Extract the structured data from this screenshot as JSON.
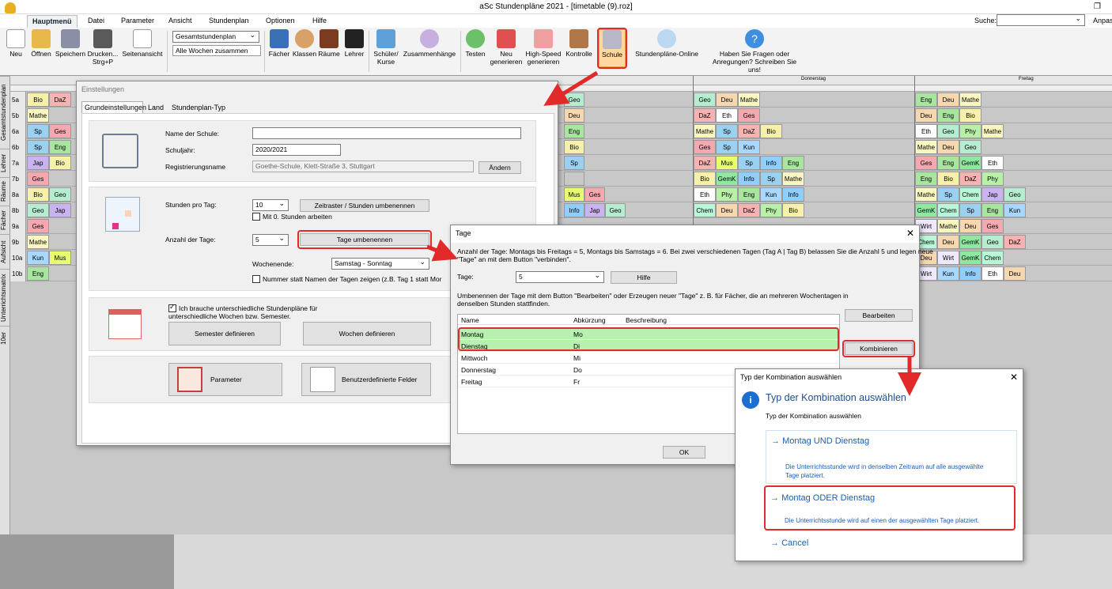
{
  "app": {
    "title": "aSc Stundenpläne 2021  - [timetable (9).roz]"
  },
  "menu": {
    "tabs": [
      "Hauptmenü",
      "Datei",
      "Parameter",
      "Ansicht",
      "Stundenplan",
      "Optionen",
      "Hilfe"
    ],
    "search_label": "Suche:",
    "anpas": "Anpas"
  },
  "ribbon": {
    "neu": "Neu",
    "oeffnen": "Öffnen",
    "speichern": "Speichern",
    "drucken": "Drucken...",
    "drucken2": "Strg+P",
    "seitenansicht": "Seitenansicht",
    "view_select": "Gesamtstundenplan",
    "alle_wochen": "Alle Wochen zusammen",
    "faecher": "Fächer",
    "klassen": "Klassen",
    "raeume": "Räume",
    "lehrer": "Lehrer",
    "schueler": "Schüler/",
    "kurse": "Kurse",
    "zusammenhaenge": "Zusammenhänge",
    "testen": "Testen",
    "neu_gen": "Neu",
    "neu_gen2": "generieren",
    "hs": "High-Speed",
    "hs2": "generieren",
    "kontrolle": "Kontrolle",
    "schule": "Schule",
    "online": "Stundenpläne-Online",
    "fragen": "Haben Sie Fragen oder",
    "fragen2": "Anregungen? Schreiben Sie uns!"
  },
  "sidetabs": [
    "Gesamtstundenplan",
    "Lehrer",
    "Räume",
    "Fächer",
    "Aufsicht",
    "Unterrichtsmatrix",
    "10er"
  ],
  "timetable": {
    "days": [
      "Donnerstag",
      "Freitag"
    ],
    "rows": [
      {
        "cls": "5a",
        "c": [
          "Bio",
          "DaZ"
        ]
      },
      {
        "cls": "5b",
        "c": [
          "Mathe"
        ]
      },
      {
        "cls": "6a",
        "c": [
          "Sp",
          "Ges"
        ]
      },
      {
        "cls": "6b",
        "c": [
          "Sp",
          "Eng"
        ]
      },
      {
        "cls": "7a",
        "c": [
          "Jap",
          "Bio"
        ]
      },
      {
        "cls": "7b",
        "c": [
          "Ges"
        ]
      },
      {
        "cls": "8a",
        "c": [
          "Bio",
          "Geo"
        ]
      },
      {
        "cls": "8b",
        "c": [
          "Geo",
          "Jap"
        ]
      },
      {
        "cls": "9a",
        "c": [
          "Ges"
        ]
      },
      {
        "cls": "9b",
        "c": [
          "Mathe"
        ]
      },
      {
        "cls": "10a",
        "c": [
          "Kun",
          "Mus"
        ]
      },
      {
        "cls": "10b",
        "c": [
          "Eng"
        ]
      }
    ],
    "right1": [
      [
        "Geo",
        "Deu",
        "Mathe"
      ],
      [
        "DaZ",
        "Eth",
        "Ges"
      ],
      [
        "Mathe",
        "Sp",
        "DaZ",
        "Bio"
      ],
      [
        "Ges",
        "Sp",
        "Kun"
      ],
      [
        "DaZ",
        "Mus",
        "Sp",
        "Info",
        "Eng"
      ],
      [
        "Bio",
        "GemK",
        "Info",
        "Sp",
        "Mathe"
      ],
      [
        "Eth",
        "Phy",
        "Eng",
        "Kun",
        "Info"
      ],
      [
        "Chem",
        "Deu",
        "DaZ",
        "Phy",
        "Bio"
      ]
    ],
    "right2": [
      [
        "Eng",
        "Deu",
        "Mathe"
      ],
      [
        "Deu",
        "Eng",
        "Bio"
      ],
      [
        "Eth",
        "Geo",
        "Phy",
        "Mathe"
      ],
      [
        "Mathe",
        "Deu",
        "Geo"
      ],
      [
        "Ges",
        "Eng",
        "GemK",
        "Eth"
      ],
      [
        "Eng",
        "Bio",
        "DaZ",
        "Phy"
      ],
      [
        "Mathe",
        "Sp",
        "Chem",
        "Jap",
        "Geo"
      ],
      [
        "GemK",
        "Chem",
        "Sp",
        "Eng",
        "Kun"
      ],
      [
        "Wirt",
        "Mathe",
        "Deu",
        "Ges"
      ],
      [
        "Chem",
        "Deu",
        "GemK",
        "Geo",
        "DaZ"
      ],
      [
        "Deu",
        "Wirt",
        "GemK",
        "Chem"
      ],
      [
        "Wirt",
        "Kun",
        "Info",
        "Eth",
        "Deu"
      ]
    ],
    "mid": [
      [
        "Geo"
      ],
      [
        "Deu"
      ],
      [
        "Eng"
      ],
      [
        "Bio"
      ],
      [
        "Sp"
      ],
      [
        ""
      ],
      [
        "Mus",
        "Ges"
      ],
      [
        "Info",
        "Jap",
        "Geo"
      ]
    ]
  },
  "einstellungen": {
    "title": "Einstellungen",
    "tabs": [
      "Grundeinstellungen",
      "Land",
      "Stundenplan-Typ"
    ],
    "name_label": "Name der Schule:",
    "name_value": "",
    "jahr_label": "Schuljahr:",
    "jahr_value": "2020/2021",
    "reg_label": "Registrierungsname",
    "reg_value": "Goethe-Schule, Klett-Straße 3, Stuttgart",
    "aendern": "Ändern",
    "stunden_label": "Stunden pro Tag:",
    "stunden_value": "10",
    "zeitraster": "Zeitraster / Stunden umbenennen",
    "null_stunden": "Mit 0. Stunden arbeiten",
    "tage_label": "Anzahl der Tage:",
    "tage_value": "5",
    "tage_umbenennen": "Tage umbenennen",
    "wochenende_label": "Wochenende:",
    "wochenende_value": "Samstag - Sonntag",
    "nummer_label": "Nummer statt Namen der Tagen zeigen (z.B. Tag 1 statt Mor",
    "unterschiedlich": "Ich brauche unterschiedliche Stundenpläne für",
    "unterschiedlich2": "unterschiedliche Wochen bzw. Semester.",
    "semester": "Semester definieren",
    "wochen": "Wochen definieren",
    "parameter": "Parameter",
    "benutzer": "Benutzerdefinierte Felder"
  },
  "tage": {
    "title": "Tage",
    "info": "Anzahl der Tage: Montags bis Freitags = 5, Montags bis Samstags = 6. Bei zwei verschiedenen Tagen (Tag A | Tag B) belassen Sie die Anzahl 5 und legen neue",
    "info2": "\"Tage\" an mit dem Button \"verbinden\".",
    "tage_label": "Tage:",
    "tage_value": "5",
    "hilfe": "Hilfe",
    "hint": "Umbenennen der Tage mit dem Button \"Bearbeiten\" oder Erzeugen neuer \"Tage\" z. B. für Fächer, die an mehreren Wochentagen in",
    "hint2": "denselben Stunden stattfinden.",
    "columns": [
      "Name",
      "Abkürzung",
      "Beschreibung"
    ],
    "rows": [
      [
        "Montag",
        "Mo"
      ],
      [
        "Dienstag",
        "Di"
      ],
      [
        "Mittwoch",
        "Mi"
      ],
      [
        "Donnerstag",
        "Do"
      ],
      [
        "Freitag",
        "Fr"
      ]
    ],
    "bearbeiten": "Bearbeiten",
    "kombinieren": "Kombinieren",
    "ok": "OK"
  },
  "kombi": {
    "title": "Typ der Kombination auswählen",
    "heading": "Typ der Kombination auswählen",
    "sub": "Typ der Kombination auswählen",
    "opt1": "Montag UND Dienstag",
    "opt1_desc": "Die Unterrichtsstunde wird in denselben Zeitraum auf alle ausgewählte",
    "opt1_desc2": "Tage platziert.",
    "opt2": "Montag ODER Dienstag",
    "opt2_desc": "Die Unterrichtsstunde wird auf einen der ausgewählten Tage platziert.",
    "cancel": "Cancel"
  },
  "colors": {
    "accent_red": "#e32a2a",
    "link_blue": "#1a5fb4",
    "row_highlight": "#b8f0b0"
  }
}
